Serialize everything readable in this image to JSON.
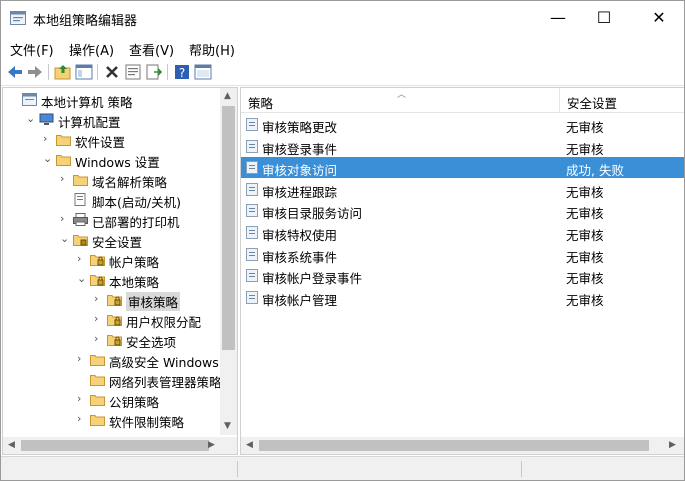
{
  "window": {
    "title": "本地组策略编辑器",
    "minimize": "—",
    "maximize": "☐",
    "close": "✕"
  },
  "menu": [
    "文件(F)",
    "操作(A)",
    "查看(V)",
    "帮助(H)"
  ],
  "tree": [
    {
      "label": "本地计算机 策略",
      "level": 0,
      "expander": "",
      "icon": "policy-icon"
    },
    {
      "label": "计算机配置",
      "level": 1,
      "expander": "⌄",
      "icon": "computer-icon"
    },
    {
      "label": "软件设置",
      "level": 2,
      "expander": "›",
      "icon": "folder-icon"
    },
    {
      "label": "Windows 设置",
      "level": 2,
      "expander": "⌄",
      "icon": "folder-icon"
    },
    {
      "label": "域名解析策略",
      "level": 3,
      "expander": "›",
      "icon": "folder-icon"
    },
    {
      "label": "脚本(启动/关机)",
      "level": 3,
      "expander": "",
      "icon": "script-icon"
    },
    {
      "label": "已部署的打印机",
      "level": 3,
      "expander": "›",
      "icon": "printer-icon"
    },
    {
      "label": "安全设置",
      "level": 3,
      "expander": "⌄",
      "icon": "security-icon"
    },
    {
      "label": "帐户策略",
      "level": 4,
      "expander": "›",
      "icon": "lock-folder-icon"
    },
    {
      "label": "本地策略",
      "level": 4,
      "expander": "⌄",
      "icon": "lock-folder-icon"
    },
    {
      "label": "审核策略",
      "level": 5,
      "expander": "›",
      "icon": "lock-folder-icon",
      "selected": true
    },
    {
      "label": "用户权限分配",
      "level": 5,
      "expander": "›",
      "icon": "lock-folder-icon"
    },
    {
      "label": "安全选项",
      "level": 5,
      "expander": "›",
      "icon": "lock-folder-icon"
    },
    {
      "label": "高级安全 Windows",
      "level": 4,
      "expander": "›",
      "icon": "folder-icon"
    },
    {
      "label": "网络列表管理器策略",
      "level": 4,
      "expander": "",
      "icon": "folder-icon"
    },
    {
      "label": "公钥策略",
      "level": 4,
      "expander": "›",
      "icon": "folder-icon"
    },
    {
      "label": "软件限制策略",
      "level": 4,
      "expander": "›",
      "icon": "folder-icon"
    }
  ],
  "list": {
    "col_policy": "策略",
    "col_setting": "安全设置",
    "rows": [
      {
        "name": "审核策略更改",
        "value": "无审核"
      },
      {
        "name": "审核登录事件",
        "value": "无审核"
      },
      {
        "name": "审核对象访问",
        "value": "成功, 失败",
        "selected": true
      },
      {
        "name": "审核进程跟踪",
        "value": "无审核"
      },
      {
        "name": "审核目录服务访问",
        "value": "无审核"
      },
      {
        "name": "审核特权使用",
        "value": "无审核"
      },
      {
        "name": "审核系统事件",
        "value": "无审核"
      },
      {
        "name": "审核帐户登录事件",
        "value": "无审核"
      },
      {
        "name": "审核帐户管理",
        "value": "无审核"
      }
    ]
  },
  "colors": {
    "selection": "#3a8fd7",
    "folder": "#f5d27a"
  }
}
